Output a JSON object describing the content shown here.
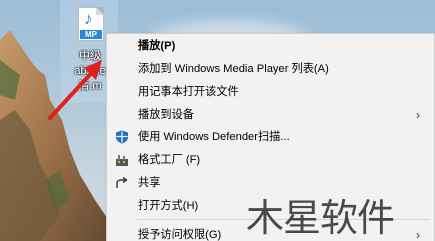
{
  "file": {
    "icon": "audio-file-icon",
    "badge": "MP",
    "name_lines": [
      "中级",
      "abilitie",
      "清.m"
    ]
  },
  "context_menu": {
    "items": [
      {
        "label": "播放(P)",
        "bold": true,
        "icon": null
      },
      {
        "label": "添加到 Windows Media Player 列表(A)",
        "icon": null
      },
      {
        "label": "用记事本打开该文件",
        "icon": null
      },
      {
        "label": "播放到设备",
        "icon": null,
        "submenu": true
      },
      {
        "label": "使用 Windows Defender扫描...",
        "icon": "shield-icon"
      },
      {
        "label": "格式工厂 (F)",
        "icon": "format-factory-icon"
      },
      {
        "label": "共享",
        "icon": "share-icon"
      },
      {
        "label": "打开方式(H)",
        "icon": null
      },
      {
        "label": "授予访问权限(G)",
        "icon": null,
        "submenu": true
      }
    ]
  },
  "watermark": {
    "text": "木星软件"
  },
  "colors": {
    "arrow": "#e02020",
    "menu_bg": "#f2f2f2",
    "shield": "#1f6fc4"
  }
}
